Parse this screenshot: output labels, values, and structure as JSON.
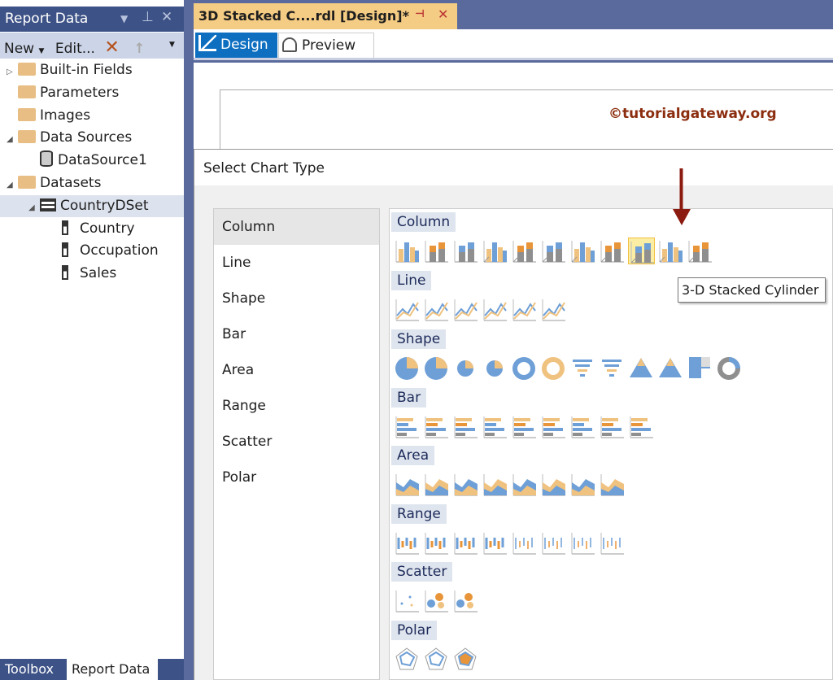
{
  "report_panel": {
    "title": "Report Data",
    "toolbar": {
      "new": "New",
      "edit": "Edit..."
    },
    "tree": [
      {
        "label": "Built-in Fields",
        "kind": "folder",
        "level": 0,
        "expander": "collapsed"
      },
      {
        "label": "Parameters",
        "kind": "folder",
        "level": 0,
        "expander": "none"
      },
      {
        "label": "Images",
        "kind": "folder",
        "level": 0,
        "expander": "none"
      },
      {
        "label": "Data Sources",
        "kind": "folder",
        "level": 0,
        "expander": "expanded"
      },
      {
        "label": "DataSource1",
        "kind": "datasource",
        "level": 1,
        "expander": "none"
      },
      {
        "label": "Datasets",
        "kind": "folder",
        "level": 0,
        "expander": "expanded"
      },
      {
        "label": "CountryDSet",
        "kind": "dataset",
        "level": 1,
        "expander": "expanded",
        "selected": true
      },
      {
        "label": "Country",
        "kind": "field",
        "level": 2,
        "expander": "none"
      },
      {
        "label": "Occupation",
        "kind": "field",
        "level": 2,
        "expander": "none"
      },
      {
        "label": "Sales",
        "kind": "field",
        "level": 2,
        "expander": "none"
      }
    ],
    "bottom_tabs": [
      "Toolbox",
      "Report Data"
    ]
  },
  "document": {
    "tab_title": "3D Stacked C....rdl [Design]*",
    "views": [
      "Design",
      "Preview"
    ],
    "watermark": "©tutorialgateway.org"
  },
  "dialog": {
    "title": "Select Chart Type",
    "categories": [
      "Column",
      "Line",
      "Shape",
      "Bar",
      "Area",
      "Range",
      "Scatter",
      "Polar"
    ],
    "selected_category": "Column",
    "gallery": [
      {
        "name": "Column",
        "count": 11
      },
      {
        "name": "Line",
        "count": 6
      },
      {
        "name": "Shape",
        "count": 12
      },
      {
        "name": "Bar",
        "count": 9
      },
      {
        "name": "Area",
        "count": 8
      },
      {
        "name": "Range",
        "count": 8
      },
      {
        "name": "Scatter",
        "count": 3
      },
      {
        "name": "Polar",
        "count": 3
      }
    ],
    "selected_icon_index": 8,
    "tooltip": "3-D Stacked Cylinder"
  },
  "colors": {
    "orange": "#e8953a",
    "tan": "#f0c27f",
    "blue": "#6e9fd6",
    "gray": "#8f8f8f",
    "arrow": "#8b1a10"
  }
}
